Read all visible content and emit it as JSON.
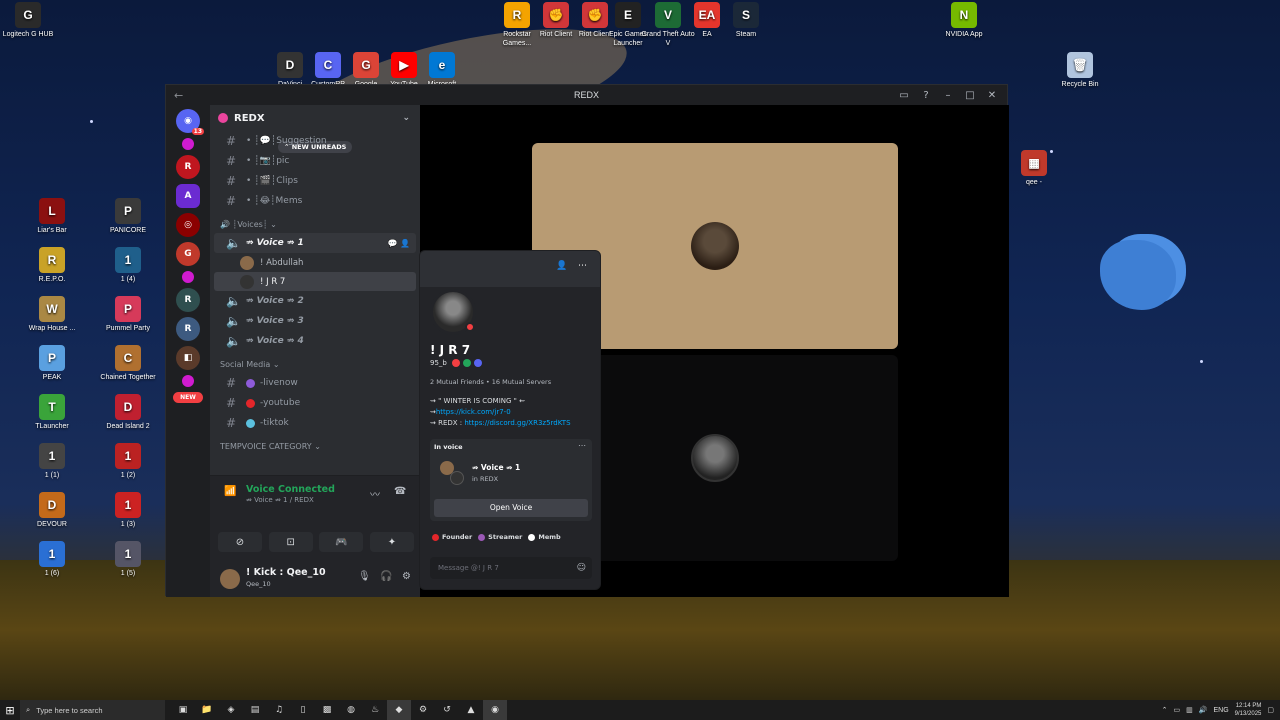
{
  "desktop": {
    "top_icons": [
      {
        "label": "Logitech G HUB",
        "color": "#2a2a2a",
        "glyph": "G"
      },
      {
        "label": "Rockstar Games...",
        "color": "#f4a300",
        "glyph": "R"
      },
      {
        "label": "Riot Client",
        "color": "#d13639",
        "glyph": "✊"
      },
      {
        "label": "Riot Client",
        "color": "#d13639",
        "glyph": "✊"
      },
      {
        "label": "Epic Games Launcher",
        "color": "#222",
        "glyph": "E"
      },
      {
        "label": "Grand Theft Auto V",
        "color": "#1d6b35",
        "glyph": "V"
      },
      {
        "label": "EA",
        "color": "#e4352c",
        "glyph": "EA"
      },
      {
        "label": "Steam",
        "color": "#1b2838",
        "glyph": "S"
      },
      {
        "label": "NVIDIA App",
        "color": "#76b900",
        "glyph": "N"
      },
      {
        "label": "DaVinci",
        "color": "#333",
        "glyph": "D"
      },
      {
        "label": "CustomRP",
        "color": "#5865f2",
        "glyph": "C"
      },
      {
        "label": "Google",
        "color": "#db4437",
        "glyph": "G"
      },
      {
        "label": "YouTube",
        "color": "#ff0000",
        "glyph": "▶"
      },
      {
        "label": "Microsoft",
        "color": "#0078d4",
        "glyph": "e"
      },
      {
        "label": "Recycle Bin",
        "color": "#b0c4de",
        "glyph": "🗑"
      },
      {
        "label": "qee -",
        "color": "#c0392b",
        "glyph": "▦"
      }
    ],
    "left_icons": [
      {
        "label": "Liar's Bar",
        "color": "#8b1010",
        "glyph": "L"
      },
      {
        "label": "PANICORE",
        "color": "#3a3a3a",
        "glyph": "P"
      },
      {
        "label": "R.E.P.O.",
        "color": "#c9a227",
        "glyph": "R"
      },
      {
        "label": "1 (4)",
        "color": "#1f5f8b",
        "glyph": "1"
      },
      {
        "label": "Wrap House ...",
        "color": "#a84",
        "glyph": "W"
      },
      {
        "label": "Pummel Party",
        "color": "#d63a5a",
        "glyph": "P"
      },
      {
        "label": "PEAK",
        "color": "#5aa0e0",
        "glyph": "P"
      },
      {
        "label": "Chained Together",
        "color": "#b07030",
        "glyph": "C"
      },
      {
        "label": "TLauncher",
        "color": "#3aa43a",
        "glyph": "T"
      },
      {
        "label": "Dead Island 2",
        "color": "#c02030",
        "glyph": "D"
      },
      {
        "label": "1 (1)",
        "color": "#444",
        "glyph": "1"
      },
      {
        "label": "1 (2)",
        "color": "#b22",
        "glyph": "1"
      },
      {
        "label": "DEVOUR",
        "color": "#c46a1a",
        "glyph": "D"
      },
      {
        "label": "1 (3)",
        "color": "#c22",
        "glyph": "1"
      },
      {
        "label": "1 (6)",
        "color": "#2a6fd4",
        "glyph": "1"
      },
      {
        "label": "1 (5)",
        "color": "#556",
        "glyph": "1"
      }
    ]
  },
  "window": {
    "title": "REDX",
    "back": "←",
    "forward": "→"
  },
  "server": {
    "name": "REDX",
    "new_unreads": "NEW UNREADS",
    "new_label": "NEW",
    "mention_count": "13"
  },
  "channels": {
    "text_top": [
      {
        "name": "Suggestion",
        "prefix": "• ┊💬┊"
      },
      {
        "name": "pic",
        "prefix": "• ┊📷┊"
      },
      {
        "name": "Clips",
        "prefix": "• ┊🎬┊"
      },
      {
        "name": "Mems",
        "prefix": "• ┊😂┊"
      }
    ],
    "voices_category": "Voices",
    "voice_channels": [
      {
        "name": "Voice ⇏ 1"
      },
      {
        "name": "Voice ⇏ 2"
      },
      {
        "name": "Voice ⇏ 3"
      },
      {
        "name": "Voice ⇏ 4"
      }
    ],
    "voice_users": [
      {
        "name": "! Abdullah",
        "color": "#8a6a4a"
      },
      {
        "name": "! J R 7",
        "color": "#333"
      }
    ],
    "social_category": "Social Media",
    "social": [
      {
        "name": "-livenow",
        "color": "#8e5bd9"
      },
      {
        "name": "-youtube",
        "color": "#e3262a"
      },
      {
        "name": "-tiktok",
        "color": "#5bc0de"
      }
    ],
    "tempvoice_category": "TEMPVOICE CATEGORY"
  },
  "voice_panel": {
    "status": "Voice Connected",
    "channel": "⇏ Voice ⇏ 1 / REDX"
  },
  "user_panel": {
    "name": "! Kick : Qee_10",
    "sub": "Qee_10"
  },
  "profile": {
    "display_name": "! J R 7",
    "username": "95_b",
    "mutuals": "2 Mutual Friends • 16 Mutual Servers",
    "bio_line1": "⇝ \" WINTER IS COMING \" ⇜",
    "bio_line2_prefix": "⇝",
    "bio_link1": "https://kick.com/jr7-0",
    "bio_line3_prefix": "⇝ REDX : ",
    "bio_link2": "https://discord.gg/XR3z5rdKTS",
    "in_voice_label": "In voice",
    "voice_channel": "⇏ Voice ⇏ 1",
    "voice_server": "in REDX",
    "open_voice": "Open Voice",
    "roles": [
      {
        "name": "Founder",
        "color": "#e3262a"
      },
      {
        "name": "Streamer",
        "color": "#9b59b6"
      },
      {
        "name": "Memb",
        "color": "#ffffff"
      }
    ],
    "message_placeholder": "Message @! J R 7"
  },
  "taskbar": {
    "search_placeholder": "Type here to search",
    "lang": "ENG",
    "time": "12:14 PM",
    "date": "9/13/2025"
  }
}
